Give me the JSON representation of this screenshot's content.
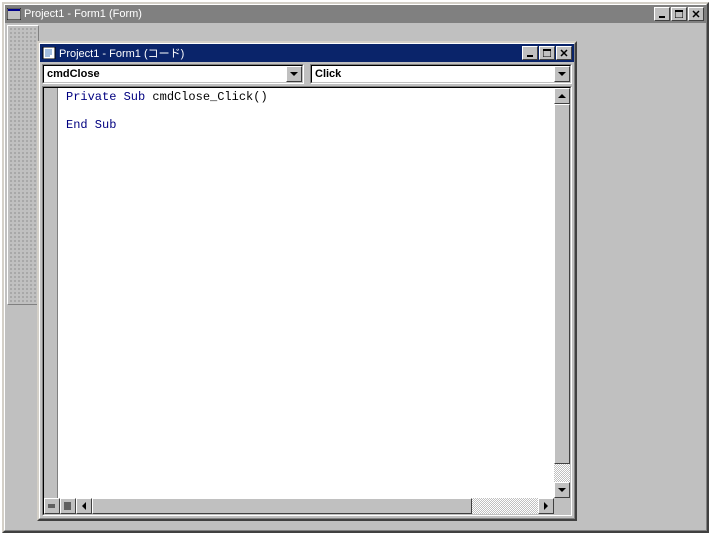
{
  "outer_window": {
    "title": "Project1 - Form1 (Form)"
  },
  "code_window": {
    "title": "Project1 - Form1 (コード)",
    "object_dropdown": "cmdClose",
    "proc_dropdown": "Click",
    "code": {
      "line1_kw": "Private Sub",
      "line1_rest": " cmdClose_Click()",
      "line3_kw": "End Sub"
    }
  }
}
